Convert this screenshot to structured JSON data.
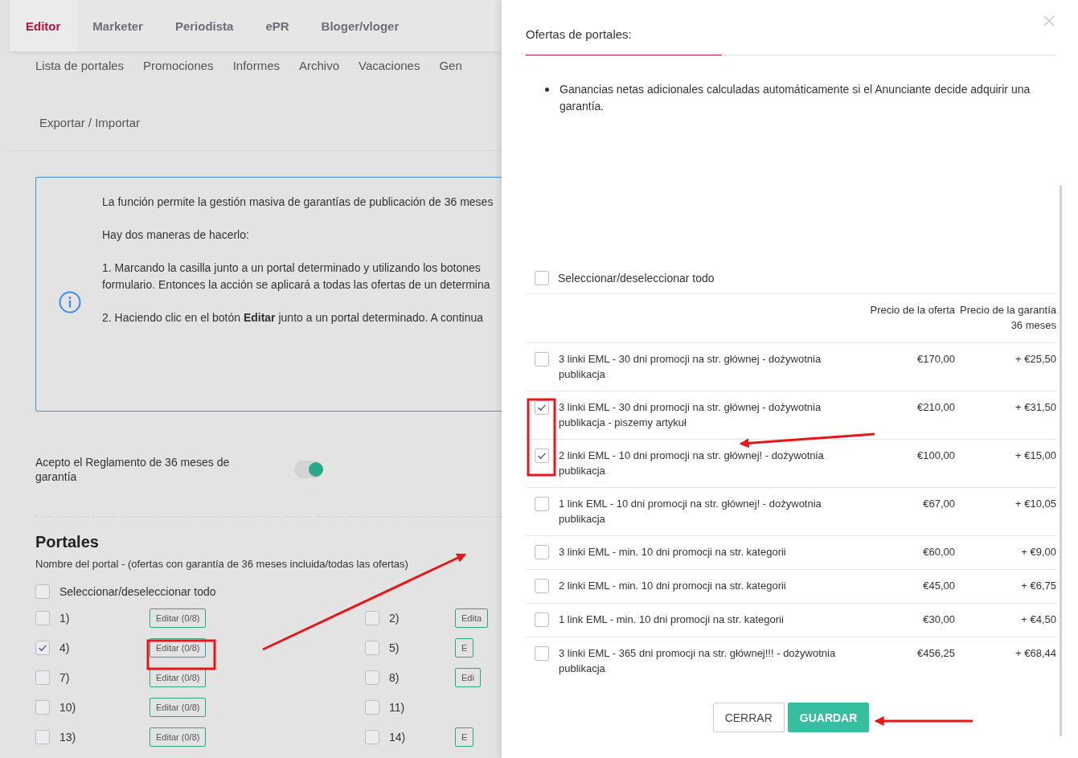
{
  "top_tabs": [
    {
      "label": "Editor",
      "selected": true
    },
    {
      "label": "Marketer",
      "selected": false
    },
    {
      "label": "Periodista",
      "selected": false
    },
    {
      "label": "ePR",
      "selected": false
    },
    {
      "label": "Bloger/vloger",
      "selected": false
    }
  ],
  "sub_nav": [
    "Lista de portales",
    "Promociones",
    "Informes",
    "Archivo",
    "Vacaciones",
    "Gen",
    "Exportar / Importar"
  ],
  "info": {
    "paragraphs": [
      "La función permite la gestión masiva de garantías de publicación de 36 meses",
      "Hay dos maneras de hacerlo:",
      "1. Marcando la casilla junto a un portal determinado y utilizando los botones\nformulario. Entonces la acción se aplicará a todas las ofertas de un determina",
      "2. Haciendo clic en el botón **Editar** junto a un portal determinado. A continua"
    ]
  },
  "agreement": {
    "label": "Acepto el Reglamento de 36 meses de garantía",
    "on": true
  },
  "portals": {
    "title": "Portales",
    "subtitle": "Nombre del portal - (ofertas con garantía de 36 meses incluida/todas las ofertas)",
    "select_all": {
      "label": "Seleccionar/deseleccionar todo",
      "checked": false
    },
    "items": [
      {
        "label": "1)",
        "checked": false,
        "edit_button": "Editar (0/8)"
      },
      {
        "label": "2)",
        "checked": false,
        "edit_button": "Edita"
      },
      {
        "label": "4)",
        "checked": true,
        "edit_button": "Editar (0/8)"
      },
      {
        "label": "5)",
        "checked": false,
        "edit_button": "E"
      },
      {
        "label": "7)",
        "checked": false,
        "edit_button": "Editar (0/8)"
      },
      {
        "label": "8)",
        "checked": false,
        "edit_button": "Edi"
      },
      {
        "label": "10)",
        "checked": false,
        "edit_button": "Editar (0/8)"
      },
      {
        "label": "11)",
        "checked": false
      },
      {
        "label": "13)",
        "checked": false,
        "edit_button": "Editar (0/8)"
      },
      {
        "label": "14)",
        "checked": false,
        "edit_button": "E"
      }
    ]
  },
  "drawer": {
    "title": "Ofertas de portales:",
    "notes": [
      "Ganancias netas adicionales calculadas automáticamente si el Anunciante decide adquirir una garantía."
    ],
    "select_all": {
      "label": "Seleccionar/deseleccionar todo",
      "checked": false
    },
    "columns": [
      "Precio de la oferta",
      "Precio de la garantía\n36 meses"
    ],
    "offers": [
      {
        "name": "3 linki EML - 30 dni promocji na str. głównej - dożywotnia publikacja",
        "checked": false,
        "price": "€170,00",
        "guarantee": "+ €25,50"
      },
      {
        "name": "3 linki EML - 30 dni promocji na str. głównej - dożywotnia publikacja - piszemy artykuł",
        "checked": true,
        "price": "€210,00",
        "guarantee": "+ €31,50"
      },
      {
        "name": "2 linki EML - 10 dni promocji na str. głównej! - dożywotnia publikacja",
        "checked": true,
        "price": "€100,00",
        "guarantee": "+ €15,00"
      },
      {
        "name": "1 link EML - 10 dni promocji na str. głównej! - dożywotnia publikacja",
        "checked": false,
        "price": "€67,00",
        "guarantee": "+ €10,05"
      },
      {
        "name": "3 linki EML - min. 10 dni promocji na str. kategorii",
        "checked": false,
        "price": "€60,00",
        "guarantee": "+ €9,00"
      },
      {
        "name": "2 linki EML - min. 10 dni promocji na str. kategorii",
        "checked": false,
        "price": "€45,00",
        "guarantee": "+ €6,75"
      },
      {
        "name": "1 link EML - min. 10 dni promocji na str. kategorii",
        "checked": false,
        "price": "€30,00",
        "guarantee": "+ €4,50"
      },
      {
        "name": "3 linki EML - 365 dni promocji na str. głównej!!! - dożywotnia publikacja",
        "checked": false,
        "price": "€456,25",
        "guarantee": "+ €68,44"
      }
    ],
    "buttons": [
      {
        "label": "CERRAR",
        "kind": "secondary"
      },
      {
        "label": "GUARDAR",
        "kind": "primary"
      }
    ]
  }
}
